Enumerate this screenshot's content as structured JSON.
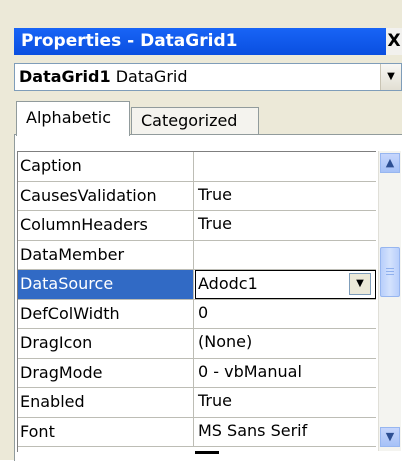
{
  "window": {
    "title": "Properties - DataGrid1",
    "close_glyph": "X"
  },
  "object_selector": {
    "name": "DataGrid1",
    "type": "DataGrid",
    "arrow_icon": "chevron-down-icon"
  },
  "tabs": [
    {
      "label": "Alphabetic",
      "active": true
    },
    {
      "label": "Categorized",
      "active": false
    }
  ],
  "properties": [
    {
      "name": "Caption",
      "value": ""
    },
    {
      "name": "CausesValidation",
      "value": "True"
    },
    {
      "name": "ColumnHeaders",
      "value": "True"
    },
    {
      "name": "DataMember",
      "value": ""
    },
    {
      "name": "DataSource",
      "value": "Adodc1",
      "selected": true
    },
    {
      "name": "DefColWidth",
      "value": "0"
    },
    {
      "name": "DragIcon",
      "value": "(None)"
    },
    {
      "name": "DragMode",
      "value": "0 - vbManual"
    },
    {
      "name": "Enabled",
      "value": "True"
    },
    {
      "name": "Font",
      "value": "MS Sans Serif"
    }
  ],
  "scrollbar": {
    "up_icon": "arrow-up-icon",
    "down_icon": "arrow-down-icon"
  },
  "colors": {
    "title_bar": "#0a4fe0",
    "selection": "#316ac5",
    "face": "#ece9d8"
  }
}
